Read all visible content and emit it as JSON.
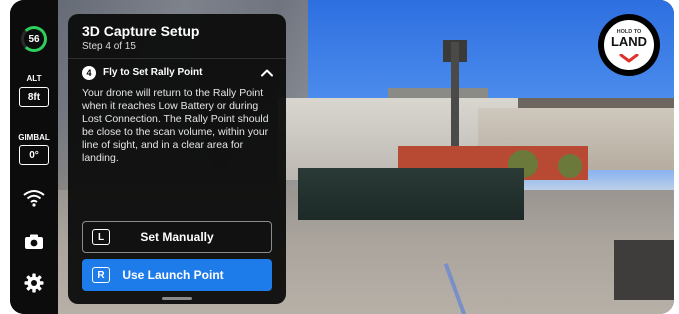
{
  "status": {
    "battery": "56",
    "altitude_label": "ALT",
    "altitude_value": "8ft",
    "gimbal_label": "GIMBAL",
    "gimbal_value": "0°"
  },
  "panel": {
    "title": "3D Capture Setup",
    "step": "Step 4 of 15",
    "step_number": "4",
    "step_title": "Fly to Set Rally Point",
    "step_body": "Your drone will return to the Rally Point when it reaches Low Battery or during Lost Connection. The Rally Point should be close to the scan volume, within your line of sight, and in a clear area for landing.",
    "buttons": [
      {
        "key": "L",
        "label": "Set Manually"
      },
      {
        "key": "R",
        "label": "Use Launch Point"
      }
    ]
  },
  "land": {
    "small": "HOLD TO",
    "big": "LAND"
  },
  "colors": {
    "accent": "#1e7bea",
    "battery": "#2fcf5e",
    "land_chevron": "#e0322b"
  },
  "icons": [
    "wifi-signal-icon",
    "camera-icon",
    "gear-icon",
    "chevron-up-icon",
    "chevron-down-icon"
  ]
}
